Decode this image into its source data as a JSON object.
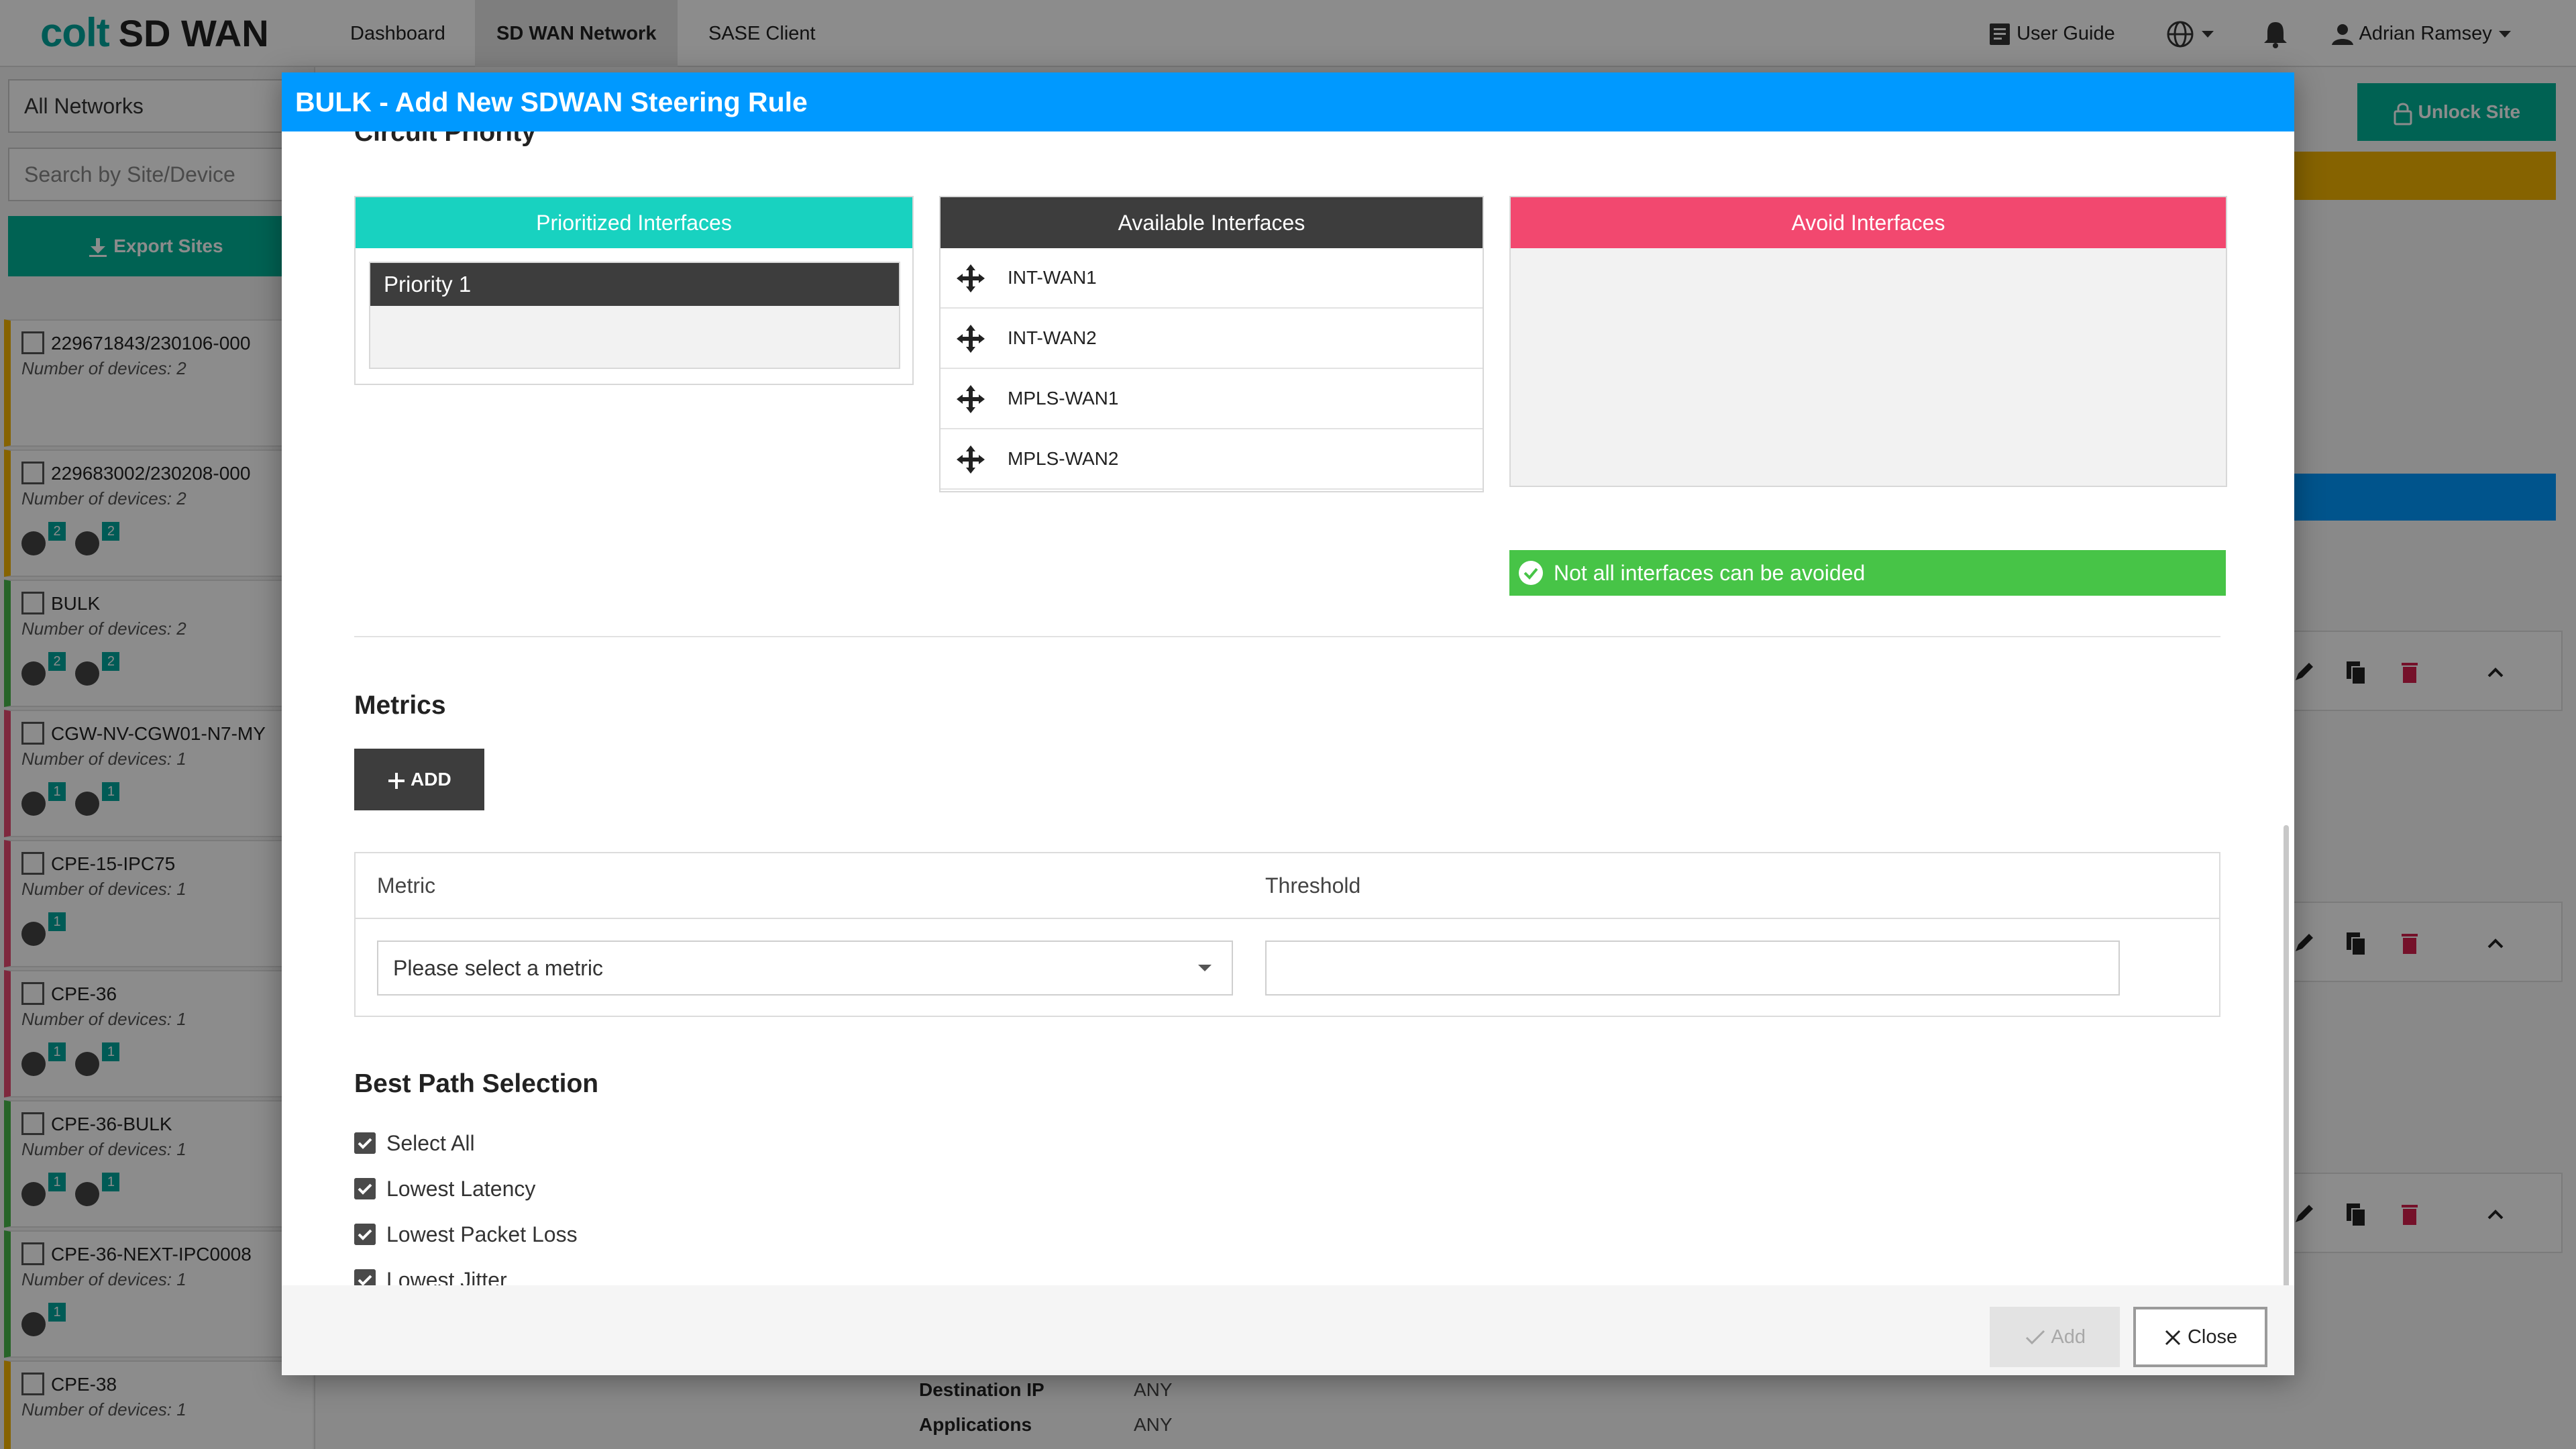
{
  "app": {
    "logo_brand": "colt",
    "logo_product": "SD WAN",
    "nav": [
      {
        "label": "Dashboard"
      },
      {
        "label": "SD WAN Network",
        "active": true
      },
      {
        "label": "SASE Client"
      }
    ],
    "user_guide": "User Guide",
    "user_name": "Adrian Ramsey"
  },
  "sidebar": {
    "network_select": "All Networks",
    "search_placeholder": "Search by Site/Device",
    "export_label": "Export Sites",
    "sites": [
      {
        "name": "229671843/230106-000",
        "devices": "Number of devices: 2",
        "color": "#f4b400"
      },
      {
        "name": "229683002/230208-000",
        "devices": "Number of devices: 2",
        "color": "#f4b400",
        "count_a": "2",
        "count_b": "2"
      },
      {
        "name": "BULK",
        "devices": "Number of devices: 2",
        "color": "#47b749",
        "count_a": "2",
        "count_b": "2"
      },
      {
        "name": "CGW-NV-CGW01-N7-MY",
        "devices": "Number of devices: 1",
        "color": "#e54a6f",
        "count_a": "1",
        "count_b": "1"
      },
      {
        "name": "CPE-15-IPC75",
        "devices": "Number of devices: 1",
        "color": "#e54a6f",
        "count_b": "1"
      },
      {
        "name": "CPE-36",
        "devices": "Number of devices: 1",
        "color": "#e54a6f",
        "count_a": "1",
        "count_b": "1"
      },
      {
        "name": "CPE-36-BULK",
        "devices": "Number of devices: 1",
        "color": "#47b749",
        "count_a": "1",
        "count_b": "1"
      },
      {
        "name": "CPE-36-NEXT-IPC0008",
        "devices": "Number of devices: 1",
        "color": "#47b749",
        "count_b": "1"
      },
      {
        "name": "CPE-38",
        "devices": "Number of devices: 1",
        "color": "#f4b400"
      }
    ]
  },
  "main": {
    "unlock_label": "Unlock Site",
    "destination_ip_label": "Destination IP",
    "destination_ip_value": "ANY",
    "applications_label": "Applications",
    "applications_value": "ANY"
  },
  "modal": {
    "title": "BULK - Add New SDWAN Steering Rule",
    "circuit_priority_title": "Circuit Priority",
    "prioritized_label": "Prioritized Interfaces",
    "priority_1_label": "Priority 1",
    "available_label": "Available Interfaces",
    "available_interfaces": [
      "INT-WAN1",
      "INT-WAN2",
      "MPLS-WAN1",
      "MPLS-WAN2"
    ],
    "avoid_label": "Avoid Interfaces",
    "avoid_status": "Not all interfaces can be avoided",
    "metrics_title": "Metrics",
    "add_metric_label": "ADD",
    "metric_col": "Metric",
    "threshold_col": "Threshold",
    "metric_placeholder": "Please select a metric",
    "threshold_value": "",
    "best_path_title": "Best Path Selection",
    "best_path_options": [
      {
        "label": "Select All",
        "checked": true
      },
      {
        "label": "Lowest Latency",
        "checked": true
      },
      {
        "label": "Lowest Packet Loss",
        "checked": true
      },
      {
        "label": "Lowest Jitter",
        "checked": true
      }
    ],
    "footer_add_label": "Add",
    "footer_close_label": "Close"
  },
  "colors": {
    "header_blue": "#0099ff",
    "prioritized_teal": "#18d2c0",
    "available_dark": "#3d3d3d",
    "avoid_pink": "#f2486f",
    "ok_green": "#47c447",
    "brand_teal": "#00a79d"
  }
}
